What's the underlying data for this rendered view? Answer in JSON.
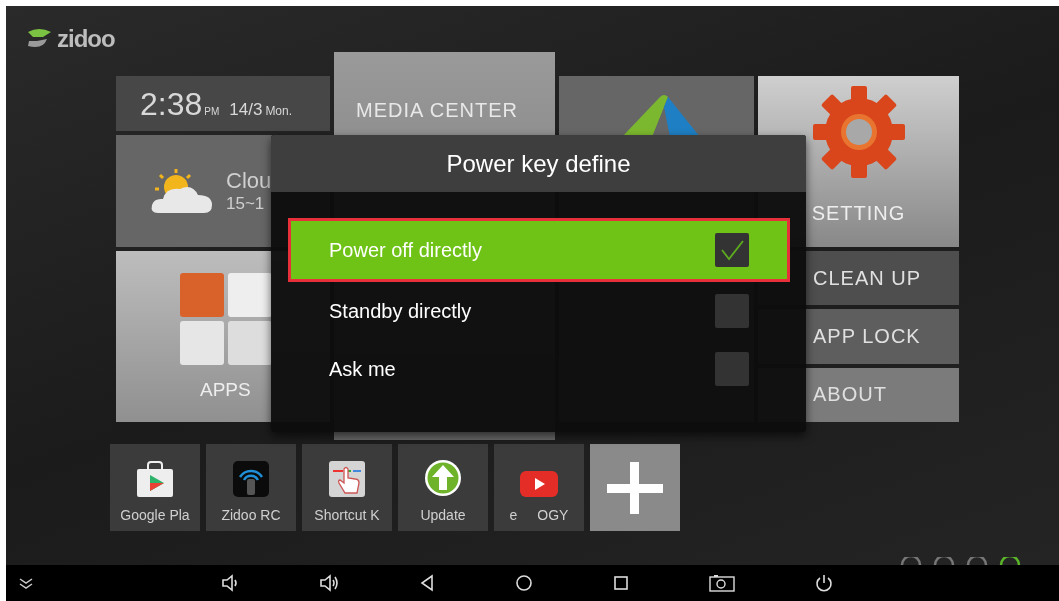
{
  "logo": {
    "text": "zidoo"
  },
  "clock": {
    "time": "2:38",
    "ampm": "PM",
    "date": "14/3",
    "weekday": "Mon."
  },
  "weather": {
    "condition": "Clou",
    "temperature": "15~1"
  },
  "media_center": {
    "label": "MEDIA CENTER"
  },
  "apps": {
    "label": "APPS"
  },
  "setting": {
    "label": "SETTING"
  },
  "side_tiles": [
    {
      "label": "CLEAN UP"
    },
    {
      "label": "APP LOCK"
    },
    {
      "label": "ABOUT"
    }
  ],
  "dock": [
    {
      "kind": "play-store",
      "labels": [
        "Google Pla"
      ]
    },
    {
      "kind": "remote",
      "labels": [
        "Zidoo RC"
      ]
    },
    {
      "kind": "shortcut",
      "labels": [
        "Shortcut K"
      ]
    },
    {
      "kind": "update",
      "labels": [
        "Update"
      ]
    },
    {
      "kind": "video",
      "labels": [
        "e",
        "OGY"
      ]
    },
    {
      "kind": "add"
    }
  ],
  "dialog": {
    "title": "Power key define",
    "options": [
      {
        "label": "Power off directly",
        "selected": true,
        "checked": true
      },
      {
        "label": "Standby directly",
        "selected": false,
        "checked": false
      },
      {
        "label": "Ask me",
        "selected": false,
        "checked": false
      }
    ]
  }
}
